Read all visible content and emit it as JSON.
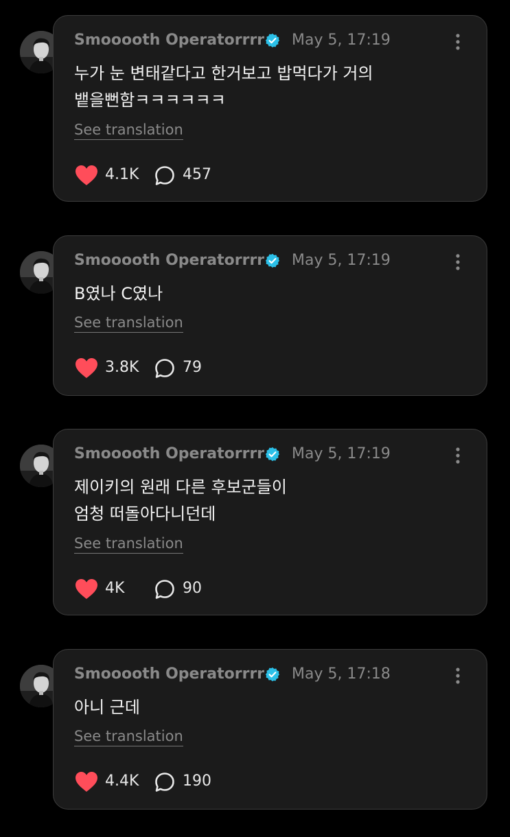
{
  "colors": {
    "background": "#000000",
    "card": "#1b1b1b",
    "card_border": "#3c3c3c",
    "muted_text": "#8a8a8a",
    "heart": "#ff4d5a",
    "verified": "#2bc0e8"
  },
  "posts": [
    {
      "username": "Smooooth Operatorrrr",
      "timestamp": "May 5, 17:19",
      "text": "누가 눈 변태같다고 한거보고 밥먹다가 거의\n뱉을뻔함ㅋㅋㅋㅋㅋㅋ",
      "translate_label": "See translation",
      "likes": "4.1K",
      "replies": "457",
      "icons": [
        "avatar",
        "verified-badge-icon",
        "more-options-icon",
        "heart-icon",
        "reply-bubble-icon"
      ]
    },
    {
      "username": "Smooooth Operatorrrr",
      "timestamp": "May 5, 17:19",
      "text": "B였나 C였나",
      "translate_label": "See translation",
      "likes": "3.8K",
      "replies": "79",
      "icons": [
        "avatar",
        "verified-badge-icon",
        "more-options-icon",
        "heart-icon",
        "reply-bubble-icon"
      ]
    },
    {
      "username": "Smooooth Operatorrrr",
      "timestamp": "May 5, 17:19",
      "text": "제이키의 원래 다른 후보군들이\n엄청 떠돌아다니던데",
      "translate_label": "See translation",
      "likes": "4K",
      "replies": "90",
      "icons": [
        "avatar",
        "verified-badge-icon",
        "more-options-icon",
        "heart-icon",
        "reply-bubble-icon"
      ]
    },
    {
      "username": "Smooooth Operatorrrr",
      "timestamp": "May 5, 17:18",
      "text": "아니 근데",
      "translate_label": "See translation",
      "likes": "4.4K",
      "replies": "190",
      "icons": [
        "avatar",
        "verified-badge-icon",
        "more-options-icon",
        "heart-icon",
        "reply-bubble-icon"
      ]
    }
  ]
}
